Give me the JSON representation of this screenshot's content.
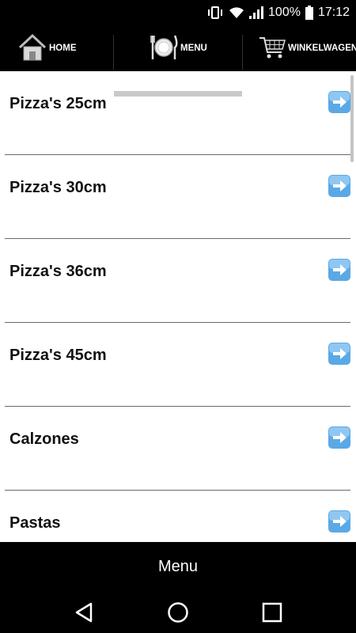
{
  "status_bar": {
    "battery": "100%",
    "time": "17:12"
  },
  "top_nav": {
    "tabs": [
      {
        "label": "HOME",
        "icon": "house-icon"
      },
      {
        "label": "MENU",
        "icon": "plate-cutlery-icon",
        "active": true
      },
      {
        "label": "WINKELWAGEN",
        "icon": "shopping-cart-icon"
      }
    ]
  },
  "menu": {
    "items": [
      {
        "label": "Pizza's 25cm"
      },
      {
        "label": "Pizza's 30cm"
      },
      {
        "label": "Pizza's 36cm"
      },
      {
        "label": "Pizza's 45cm"
      },
      {
        "label": "Calzones"
      },
      {
        "label": "Pastas"
      }
    ]
  },
  "bottom_bar": {
    "title": "Menu"
  },
  "colors": {
    "bar": "#000000",
    "arrow_blue": "#5aa9e6",
    "active_tab": "#c9c9c9"
  }
}
